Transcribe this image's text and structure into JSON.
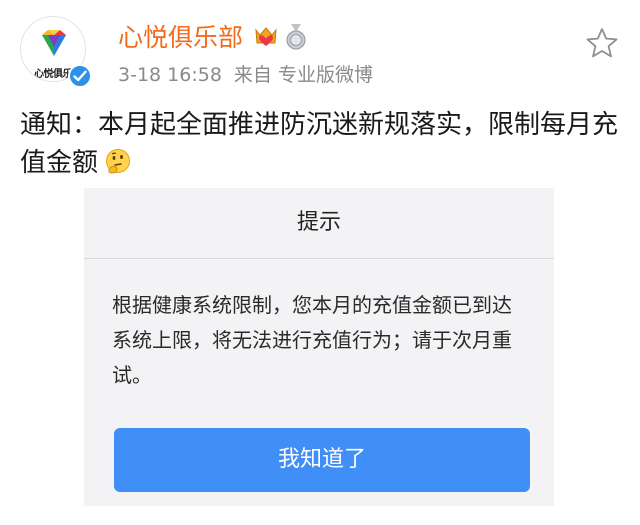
{
  "post": {
    "author": {
      "name": "心悦俱乐部",
      "avatar_text": "心悦俱乐",
      "avatar_icon": "gem-logo-icon",
      "verified_icon": "verified-check-icon",
      "badges": [
        "crown-heart-icon",
        "medal-icon"
      ]
    },
    "timestamp": "3-18 16:58",
    "source": "来自 专业版微博",
    "favorite_icon": "star-outline-icon",
    "text": "通知：本月起全面推进防沉迷新规落实，限制每月充值金额",
    "emoji_icon": "thinking-face-icon"
  },
  "dialog": {
    "title": "提示",
    "message": "根据健康系统限制，您本月的充值金额已到达系统上限，将无法进行充值行为；请于次月重试。",
    "button_label": "我知道了"
  },
  "colors": {
    "username": "#f26b1d",
    "meta_text": "#8a8a8a",
    "verified": "#2b92e8",
    "dialog_bg": "#f3f3f5",
    "button_bg": "#3f8ff7"
  }
}
